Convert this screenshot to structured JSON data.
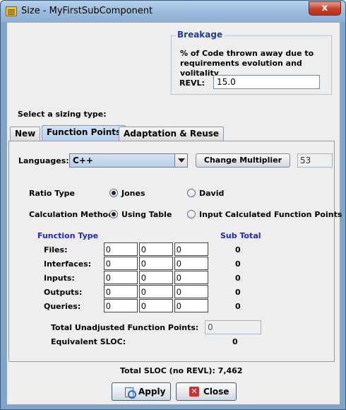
{
  "window": {
    "title": "Size - MyFirstSubComponent",
    "close_glyph": "x"
  },
  "breakage": {
    "title": "Breakage",
    "description": "% of Code thrown away due to requirements evolution and volitality",
    "revl_label": "REVL:",
    "revl_value": "15.0"
  },
  "sizing": {
    "prompt": "Select a sizing type:",
    "tabs": [
      "New",
      "Function Points",
      "Adaptation & Reuse"
    ],
    "active_tab": "Function Points"
  },
  "function_points": {
    "languages_label": "Languages:",
    "language_value": "C++",
    "change_multiplier_label": "Change Multiplier",
    "multiplier_value": "53",
    "ratio_type_label": "Ratio Type",
    "ratio_options": [
      "Jones",
      "David"
    ],
    "ratio_selected": "Jones",
    "calc_method_label": "Calculation Method",
    "calc_options": [
      "Using Table",
      "Input Calculated Function Points"
    ],
    "calc_selected": "Using Table",
    "function_type_header": "Function Type",
    "subtotal_header": "Sub Total",
    "rows": [
      {
        "label": "Files:",
        "values": [
          "0",
          "0",
          "0"
        ],
        "subtotal": "0"
      },
      {
        "label": "Interfaces:",
        "values": [
          "0",
          "0",
          "0"
        ],
        "subtotal": "0"
      },
      {
        "label": "Inputs:",
        "values": [
          "0",
          "0",
          "0"
        ],
        "subtotal": "0"
      },
      {
        "label": "Outputs:",
        "values": [
          "0",
          "0",
          "0"
        ],
        "subtotal": "0"
      },
      {
        "label": "Queries:",
        "values": [
          "0",
          "0",
          "0"
        ],
        "subtotal": "0"
      }
    ],
    "tufp_label": "Total Unadjusted Function Points:",
    "tufp_value": "0",
    "esloc_label": "Equivalent SLOC:",
    "esloc_value": "0"
  },
  "footer": {
    "total_sloc_label": "Total SLOC (no REVL): 7,462",
    "apply_label": "Apply",
    "close_label": "Close"
  },
  "colors": {
    "accent": "#1b27c6",
    "breakage_title": "#1c3e9d"
  }
}
